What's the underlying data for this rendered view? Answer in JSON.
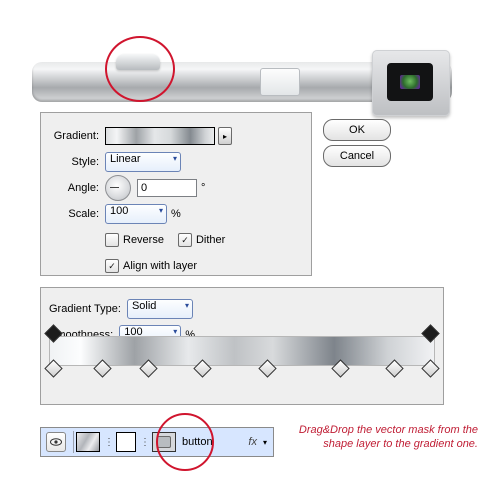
{
  "gradient_panel": {
    "gradient_label": "Gradient:",
    "style_label": "Style:",
    "style_value": "Linear",
    "angle_label": "Angle:",
    "angle_value": "0",
    "angle_unit": "°",
    "scale_label": "Scale:",
    "scale_value": "100",
    "scale_unit": "%",
    "reverse_label": "Reverse",
    "reverse_checked": false,
    "dither_label": "Dither",
    "dither_checked": true,
    "align_label": "Align with layer",
    "align_checked": true,
    "ok_label": "OK",
    "cancel_label": "Cancel"
  },
  "editor_panel": {
    "type_label": "Gradient Type:",
    "type_value": "Solid",
    "smooth_label": "Smoothness:",
    "smooth_value": "100",
    "smooth_unit": "%"
  },
  "layers": {
    "name": "button",
    "fx": "fx"
  },
  "hint": "Drag&Drop the vector mask from the shape layer to the gradient one."
}
